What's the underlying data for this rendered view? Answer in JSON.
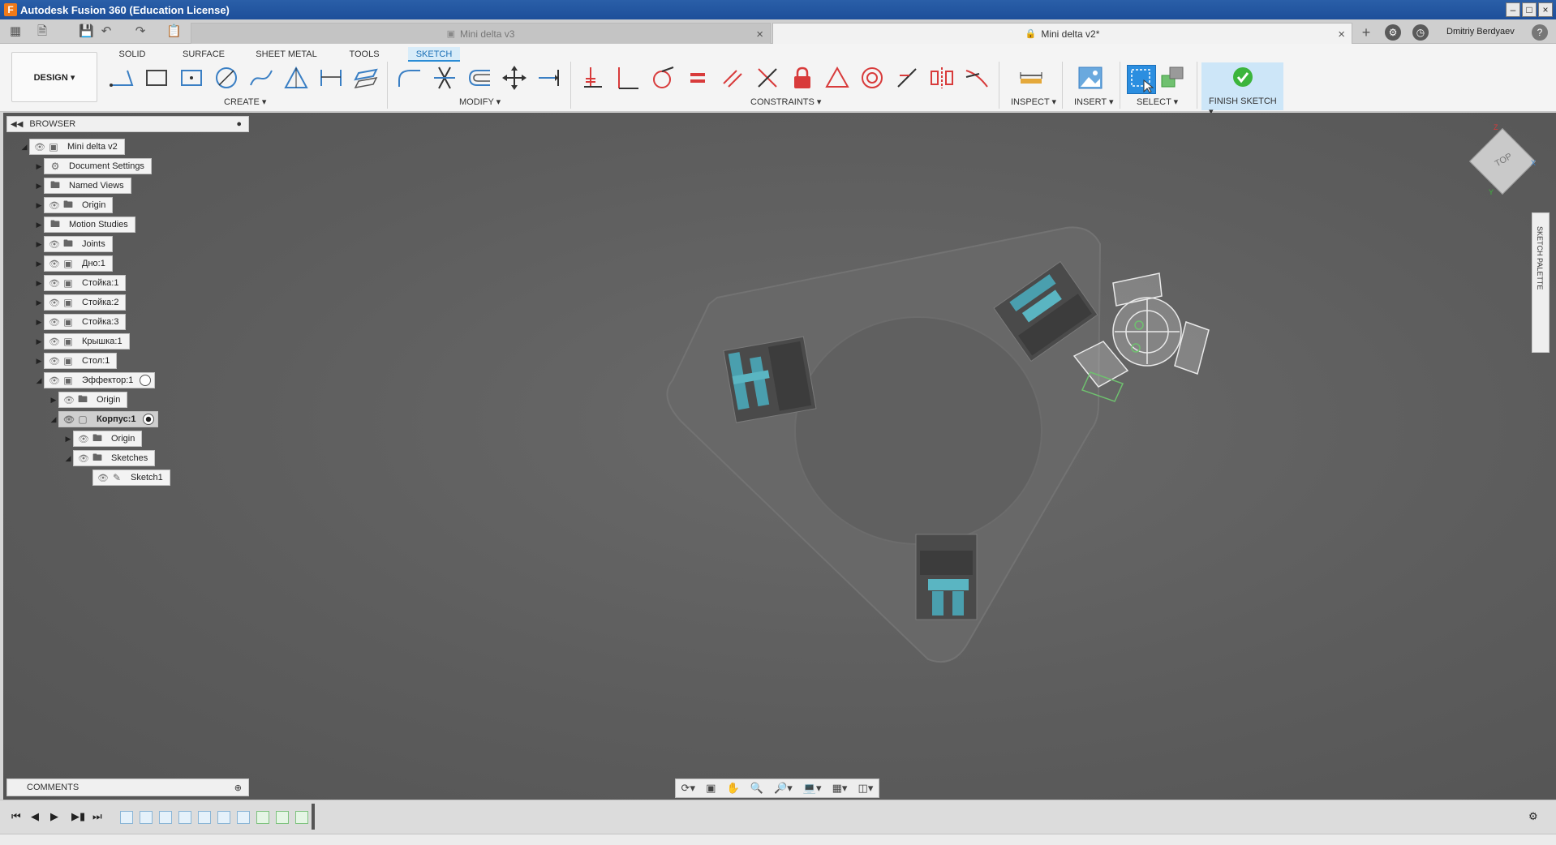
{
  "window": {
    "title": "Autodesk Fusion 360 (Education License)",
    "app_logo_letter": "F",
    "controls": [
      "–",
      "□",
      "×"
    ]
  },
  "tabs": [
    {
      "label": "Mini delta v3",
      "active": false
    },
    {
      "label": "Mini delta v2*",
      "active": true
    }
  ],
  "user": {
    "name": "Dmitriy Berdyaev"
  },
  "ribbon": {
    "workspace": "DESIGN ▾",
    "mode_tabs": [
      "SOLID",
      "SURFACE",
      "SHEET METAL",
      "TOOLS",
      "SKETCH"
    ],
    "active_mode": "SKETCH",
    "groups": {
      "create": "CREATE ▾",
      "modify": "MODIFY ▾",
      "constraints": "CONSTRAINTS ▾",
      "inspect": "INSPECT ▾",
      "insert": "INSERT ▾",
      "select": "SELECT ▾",
      "finish": "FINISH SKETCH ▾"
    }
  },
  "browser": {
    "title": "BROWSER",
    "tree": [
      {
        "label": "Mini delta v2",
        "icon": "component-icon"
      },
      {
        "label": "Document Settings",
        "icon": "gear-icon"
      },
      {
        "label": "Named Views",
        "icon": "folder-icon"
      },
      {
        "label": "Origin",
        "icon": "folder-icon"
      },
      {
        "label": "Motion Studies",
        "icon": "folder-icon"
      },
      {
        "label": "Joints",
        "icon": "folder-icon"
      },
      {
        "label": "Дно:1",
        "icon": "component-icon"
      },
      {
        "label": "Стойка:1",
        "icon": "component-icon"
      },
      {
        "label": "Стойка:2",
        "icon": "component-icon"
      },
      {
        "label": "Стойка:3",
        "icon": "component-icon"
      },
      {
        "label": "Крышка:1",
        "icon": "component-icon"
      },
      {
        "label": "Стол:1",
        "icon": "component-icon"
      },
      {
        "label": "Эффектор:1",
        "icon": "component-icon"
      },
      {
        "label": "Origin",
        "icon": "folder-icon"
      },
      {
        "label": "Корпус:1",
        "icon": "body-icon"
      },
      {
        "label": "Origin",
        "icon": "folder-icon"
      },
      {
        "label": "Sketches",
        "icon": "folder-icon"
      },
      {
        "label": "Sketch1",
        "icon": "sketch-icon"
      }
    ]
  },
  "viewcube": {
    "face": "TOP",
    "axes": {
      "x": "X",
      "y": "Y",
      "z": "Z"
    }
  },
  "sketch_palette": {
    "label": "SKETCH PALETTE"
  },
  "comments": {
    "title": "COMMENTS"
  },
  "colors": {
    "accent": "#2b8ee0",
    "finish_check": "#3cb53c",
    "constraint_red": "#d83b3b",
    "viewport": "#5f5f5f"
  }
}
